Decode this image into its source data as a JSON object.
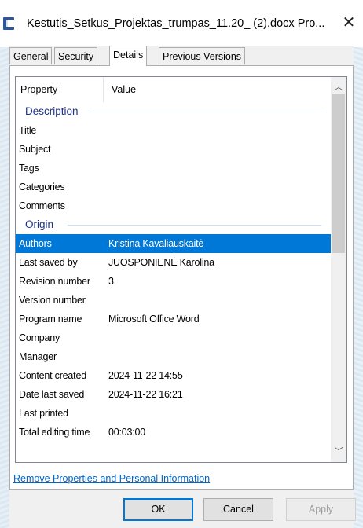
{
  "window": {
    "title": "Kestutis_Setkus_Projektas_trumpas_11.20_ (2).docx Pro...",
    "close_glyph": "✕"
  },
  "tabs": [
    "General",
    "Security",
    "Details",
    "Previous Versions"
  ],
  "active_tab": "Details",
  "columns": {
    "property": "Property",
    "value": "Value"
  },
  "groups": {
    "description": {
      "label": "Description",
      "rows": [
        {
          "property": "Title",
          "value": ""
        },
        {
          "property": "Subject",
          "value": ""
        },
        {
          "property": "Tags",
          "value": ""
        },
        {
          "property": "Categories",
          "value": ""
        },
        {
          "property": "Comments",
          "value": ""
        }
      ]
    },
    "origin": {
      "label": "Origin",
      "rows": [
        {
          "property": "Authors",
          "value": "Kristina Kavaliauskaitė",
          "selected": true
        },
        {
          "property": "Last saved by",
          "value": "JUOSPONIENĖ Karolina"
        },
        {
          "property": "Revision number",
          "value": "3"
        },
        {
          "property": "Version number",
          "value": ""
        },
        {
          "property": "Program name",
          "value": "Microsoft Office Word"
        },
        {
          "property": "Company",
          "value": ""
        },
        {
          "property": "Manager",
          "value": ""
        },
        {
          "property": "Content created",
          "value": "2024-11-22 14:55"
        },
        {
          "property": "Date last saved",
          "value": "2024-11-22 16:21"
        },
        {
          "property": "Last printed",
          "value": ""
        },
        {
          "property": "Total editing time",
          "value": "00:03:00"
        }
      ]
    }
  },
  "scrollbar": {
    "up_glyph": "︿",
    "down_glyph": "﹀"
  },
  "link": {
    "remove_properties": "Remove Properties and Personal Information"
  },
  "buttons": {
    "ok": "OK",
    "cancel": "Cancel",
    "apply": "Apply"
  },
  "colors": {
    "selection": "#0078d7",
    "group_header": "#1e3287",
    "link": "#0066cc"
  }
}
